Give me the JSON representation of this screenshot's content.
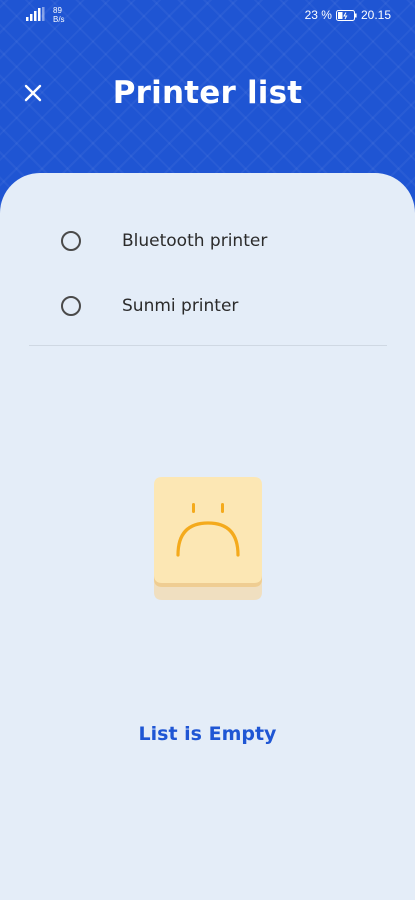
{
  "status_bar": {
    "network_speed_value": "89",
    "network_speed_unit": "B/s",
    "battery_percent": "23 %",
    "time": "20.15"
  },
  "header": {
    "title": "Printer list",
    "close_icon": "close-icon"
  },
  "printer_options": [
    {
      "label": "Bluetooth printer",
      "selected": false
    },
    {
      "label": "Sunmi printer",
      "selected": false
    }
  ],
  "empty_state": {
    "icon": "sad-face-icon",
    "message": "List is Empty"
  },
  "colors": {
    "header_blue": "#1f55d3",
    "card_background": "#e4edf8",
    "accent_text": "#1f56d4",
    "illustration_fill": "#fce7b4",
    "illustration_face": "#f4aa1c"
  }
}
